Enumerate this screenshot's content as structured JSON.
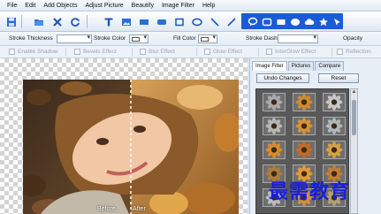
{
  "menu": [
    "File",
    "Edit",
    "Add Objects",
    "Adjust Picture",
    "Beautify",
    "Image Filter",
    "Help"
  ],
  "toolbar": {
    "file_icons": [
      "save-icon",
      "open-icon",
      "close-icon",
      "refresh-icon"
    ],
    "object_icons": [
      "text-icon",
      "image-icon",
      "rectangle-icon",
      "rounded-rectangle-icon",
      "square-icon",
      "ellipse-icon",
      "line-icon"
    ],
    "shape_icons": [
      "speech-bubble-icon",
      "rounded-square-icon",
      "star-burst-icon",
      "oval-icon",
      "cloud-icon",
      "star-icon",
      "pin-icon"
    ],
    "accent": "#1a5cd6"
  },
  "properties": {
    "stroke_thickness": "Stroke Thickness",
    "stroke_color": "Stroke Color",
    "fill_color": "Fill Color",
    "stroke_dash": "Stroke Dash",
    "opacity": "Opacity"
  },
  "effects": [
    "Enable Shadow",
    "Bevels Effect",
    "Blur Effect",
    "Glow Effect",
    "InterGlow Effect",
    "Reflection"
  ],
  "canvas": {
    "before_label": "Before",
    "after_label": "After"
  },
  "panel": {
    "tabs": [
      "Image Filter",
      "Pictures",
      "Compare"
    ],
    "undo_label": "Undo Changes",
    "reset_label": "Reset",
    "filter_tints": [
      "#a9a9a9",
      "#d08a2e",
      "#c7c7c7",
      "#b7b7b7",
      "#d79232",
      "#b0b8b8",
      "#d98c2a",
      "#c36a2a",
      "#d6a045",
      "#ac7b3d",
      "#e29a38",
      "#c17e34",
      "#bdbdbd",
      "#d38f3b",
      "#b5a070"
    ]
  },
  "watermark": "最需教育"
}
